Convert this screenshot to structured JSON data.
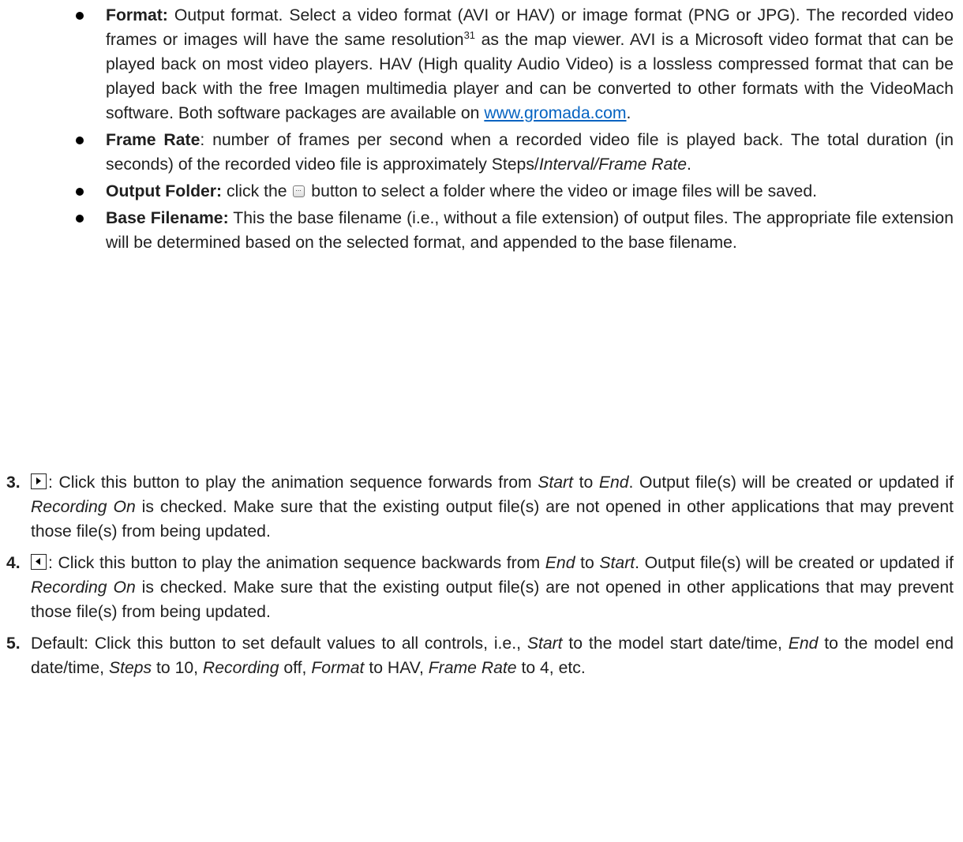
{
  "bullets": [
    {
      "label": "Format:",
      "t1": " Output format. Select a video format (AVI or HAV) or image format (PNG or JPG). The recorded video frames or images will have the same resolution",
      "sup": "31",
      "t2": " as the map viewer. AVI is a Microsoft video format that can be played back on most video players. HAV (High quality Audio Video) is a lossless compressed format that can be played back with the free Imagen multimedia player and can be converted to other formats with the VideoMach software. Both software packages are available on ",
      "link": "www.gromada.com",
      "t3": "."
    },
    {
      "label": "Frame Rate",
      "t1": ": number of frames per second when a recorded video file is played back. The total duration (in seconds) of the recorded video file is approximately Steps/",
      "em": "Interval/Frame Rate",
      "t2": "."
    },
    {
      "label": "Output Folder:",
      "t1": " click the ",
      "icon": "browse-button-icon",
      "t2": " button to select a folder where the video or image files will be saved."
    },
    {
      "label": "Base Filename:",
      "t1": " This the base filename (i.e., without a file extension) of output files. The appropriate file extension will be determined based on the selected format, and appended to the base filename."
    }
  ],
  "items": [
    {
      "num": "3.",
      "icon": "play-forward-icon",
      "t1": ": Click this button to play the animation sequence forwards from ",
      "e1": "Start",
      "t2": " to ",
      "e2": "End",
      "t3": ". Output file(s) will be created or updated if ",
      "e3": "Recording On",
      "t4": " is checked. Make sure that the existing output file(s) are not opened in other applications that may prevent those file(s) from being updated."
    },
    {
      "num": "4.",
      "icon": "play-backward-icon",
      "t1": ": Click this button to play the animation sequence backwards from ",
      "e1": "End",
      "t2": " to ",
      "e2": "Start",
      "t3": ". Output file(s) will be created or updated if ",
      "e3": "Recording On",
      "t4": " is checked. Make sure that the existing output file(s) are not opened in other applications that may prevent those file(s) from being updated."
    },
    {
      "num": "5.",
      "t1": "Default: Click this button to set default values to all controls, i.e., ",
      "e1": "Start",
      "t2": " to the model start date/time, ",
      "e2": "End",
      "t3": " to the model end date/time, ",
      "e3": "Steps",
      "t4": " to 10, ",
      "e4": "Recording",
      "t5": " off, ",
      "e5": "Format",
      "t6": " to HAV, ",
      "e6": "Frame Rate",
      "t7": " to 4, etc."
    }
  ],
  "colors": {
    "text": "#1f1f1f",
    "link": "#0563c1"
  }
}
